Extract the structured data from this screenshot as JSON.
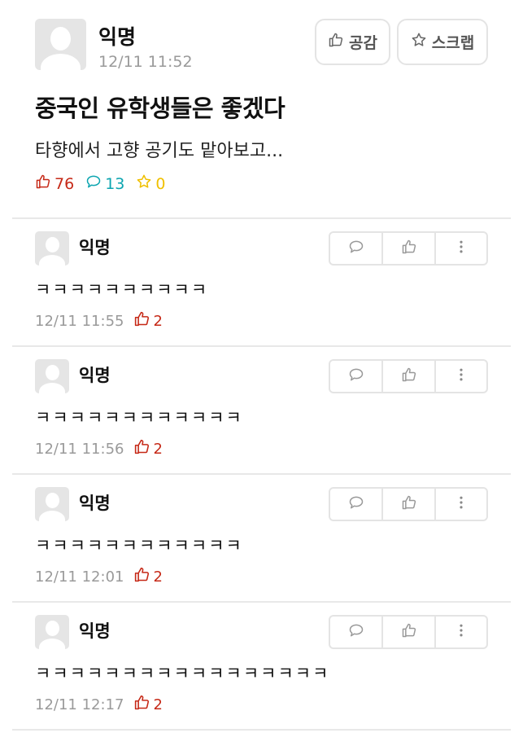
{
  "post": {
    "author": "익명",
    "time": "12/11 11:52",
    "like_button_label": "공감",
    "scrap_button_label": "스크랩",
    "title": "중국인 유학생들은 좋겠다",
    "body": "타향에서 고향 공기도 맡아보고...",
    "stats": {
      "likes": "76",
      "comments": "13",
      "scraps": "0"
    }
  },
  "colors": {
    "like": "#c62917",
    "comment": "#0ca5b0",
    "scrap": "#f0c000",
    "muted": "#9a9a9a"
  },
  "comments": [
    {
      "author": "익명",
      "text": "ㅋㅋㅋㅋㅋㅋㅋㅋㅋㅋ",
      "time": "12/11 11:55",
      "likes": "2"
    },
    {
      "author": "익명",
      "text": "ㅋㅋㅋㅋㅋㅋㅋㅋㅋㅋㅋㅋ",
      "time": "12/11 11:56",
      "likes": "2"
    },
    {
      "author": "익명",
      "text": "ㅋㅋㅋㅋㅋㅋㅋㅋㅋㅋㅋㅋ",
      "time": "12/11 12:01",
      "likes": "2"
    },
    {
      "author": "익명",
      "text": "ㅋㅋㅋㅋㅋㅋㅋㅋㅋㅋㅋㅋㅋㅋㅋㅋㅋ",
      "time": "12/11 12:17",
      "likes": "2"
    }
  ]
}
